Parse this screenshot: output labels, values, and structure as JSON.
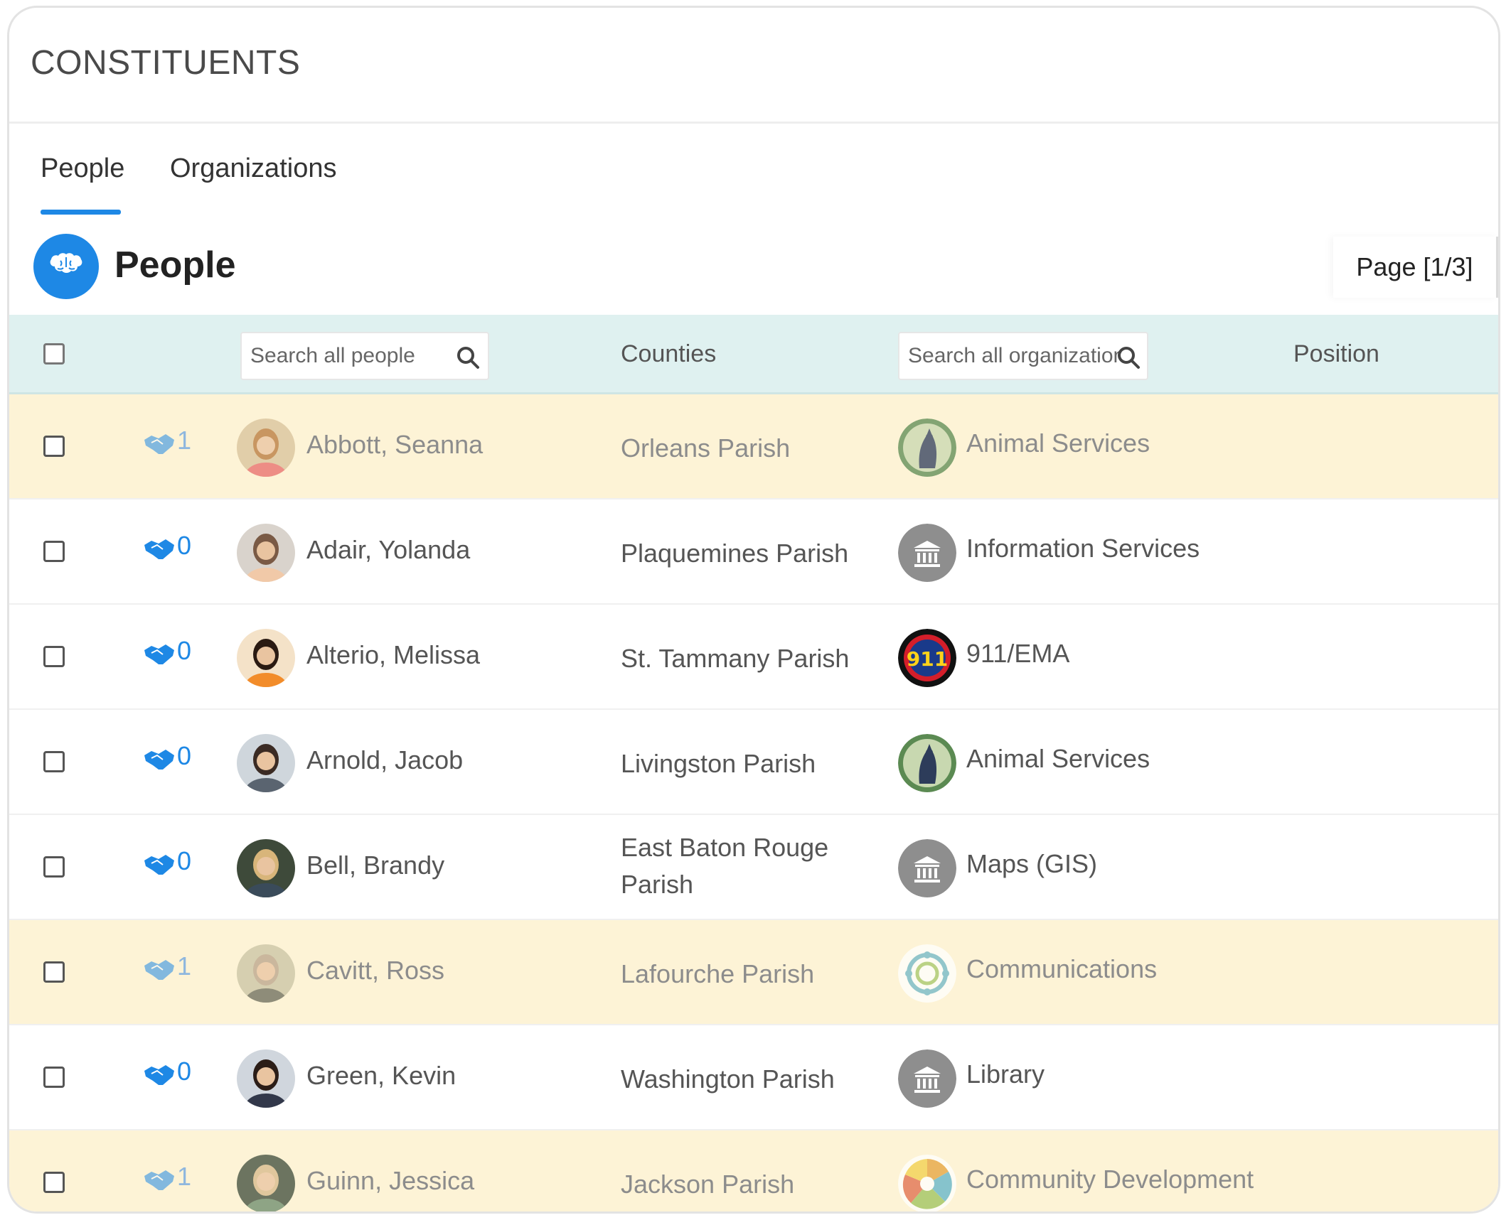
{
  "app": {
    "title": "CONSTITUENTS"
  },
  "tabs": [
    {
      "label": "People",
      "active": true
    },
    {
      "label": "Organizations",
      "active": false
    }
  ],
  "section": {
    "title": "People",
    "icon": "brain-icon",
    "pager": "Page [1/3]"
  },
  "table": {
    "search_people_placeholder": "Search all people",
    "counties_header": "Counties",
    "search_orgs_placeholder": "Search all organizations",
    "position_header": "Position",
    "rows": [
      {
        "count": "1",
        "name": "Abbott, Seanna",
        "county": "Orleans Parish",
        "org": "Animal Services",
        "org_icon": "animal-services-logo",
        "highlighted": true
      },
      {
        "count": "0",
        "name": "Adair, Yolanda",
        "county": "Plaquemines Parish",
        "org": "Information Services",
        "org_icon": "building-icon",
        "highlighted": false
      },
      {
        "count": "0",
        "name": "Alterio, Melissa",
        "county": "St. Tammany Parish",
        "org": "911/EMA",
        "org_icon": "911-logo",
        "highlighted": false
      },
      {
        "count": "0",
        "name": "Arnold, Jacob",
        "county": "Livingston Parish",
        "org": "Animal Services",
        "org_icon": "animal-services-logo",
        "highlighted": false
      },
      {
        "count": "0",
        "name": "Bell, Brandy",
        "county": "East Baton Rouge Parish",
        "org": "Maps (GIS)",
        "org_icon": "building-icon",
        "highlighted": false
      },
      {
        "count": "1",
        "name": "Cavitt, Ross",
        "county": "Lafourche Parish",
        "org": "Communications",
        "org_icon": "communications-logo",
        "highlighted": true
      },
      {
        "count": "0",
        "name": "Green, Kevin",
        "county": "Washington Parish",
        "org": "Library",
        "org_icon": "building-icon",
        "highlighted": false
      },
      {
        "count": "1",
        "name": "Guinn, Jessica",
        "county": "Jackson Parish",
        "org": "Community Development",
        "org_icon": "community-development-logo",
        "highlighted": true
      }
    ]
  },
  "colors": {
    "accent": "#1e88e5",
    "header_bg": "#dff1f0",
    "highlight_bg": "#fdf3d6"
  }
}
